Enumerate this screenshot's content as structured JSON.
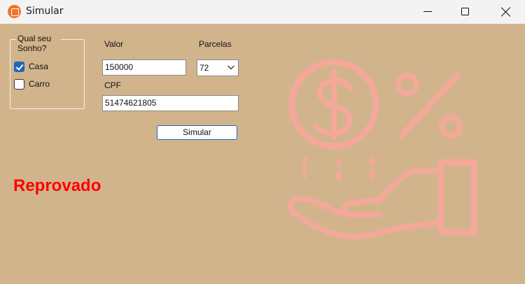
{
  "window": {
    "title": "Simular"
  },
  "group": {
    "legend": "Qual seu Sonho?",
    "options": [
      {
        "label": "Casa",
        "checked": true
      },
      {
        "label": "Carro",
        "checked": false
      }
    ]
  },
  "form": {
    "valor_label": "Valor",
    "valor_value": "150000",
    "parcelas_label": "Parcelas",
    "parcelas_value": "72",
    "cpf_label": "CPF",
    "cpf_value": "51474621805",
    "submit_label": "Simular"
  },
  "result": {
    "text": "Reprovado",
    "color": "#ff0000"
  },
  "colors": {
    "background": "#d2b48c",
    "accent": "#1f66c1",
    "illustration": "#f4a89a"
  },
  "illustration": {
    "icon": "loan-hand-coin-percent-icon"
  }
}
